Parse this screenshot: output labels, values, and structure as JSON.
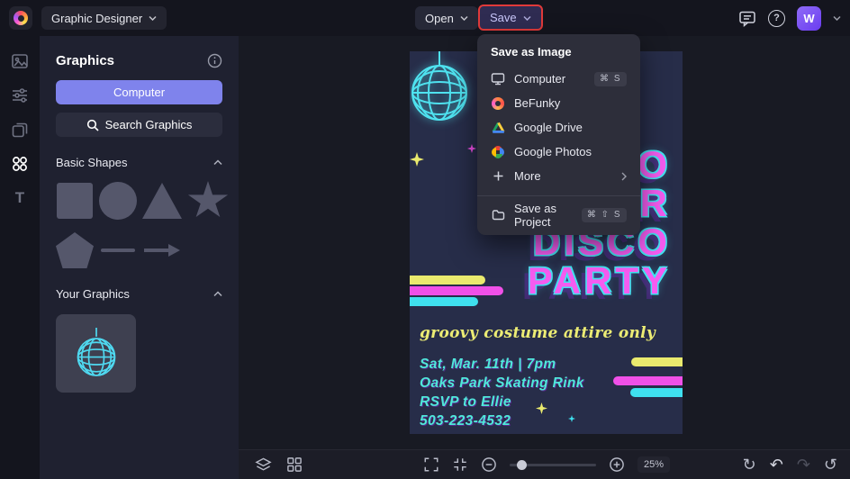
{
  "topbar": {
    "app_menu_label": "Graphic Designer",
    "open_label": "Open",
    "save_label": "Save",
    "avatar_initial": "W"
  },
  "panel": {
    "title": "Graphics",
    "computer_button_label": "Computer",
    "search_button_label": "Search Graphics",
    "basic_shapes_label": "Basic Shapes",
    "your_graphics_label": "Your Graphics"
  },
  "save_menu": {
    "header": "Save as Image",
    "items": [
      {
        "label": "Computer",
        "shortcut": "⌘ S"
      },
      {
        "label": "BeFunky"
      },
      {
        "label": "Google Drive"
      },
      {
        "label": "Google Photos"
      },
      {
        "label": "More"
      }
    ],
    "save_project_label": "Save as Project",
    "save_project_shortcut": "⌘ ⇧ S"
  },
  "poster": {
    "title_lines": [
      "RETRO",
      "ROLLER",
      "DISCO",
      "PARTY"
    ],
    "script_line": "groovy costume attire only",
    "detail_lines": [
      "Sat, Mar. 11th | 7pm",
      "Oaks Park Skating Rink",
      "RSVP to Ellie",
      "503-223-4532"
    ]
  },
  "bottom_bar": {
    "zoom_level": "25%"
  },
  "icons": {
    "help": "?",
    "refresh": "↻",
    "undo": "↶",
    "redo": "↷",
    "history": "↺",
    "text_tool": "T"
  },
  "colors": {
    "accent": "#7f83ec",
    "highlight_red": "#e03a3a",
    "poster_magenta": "#f55cf0",
    "poster_cyan": "#4fe3f0",
    "poster_yellow": "#eaea6e"
  }
}
